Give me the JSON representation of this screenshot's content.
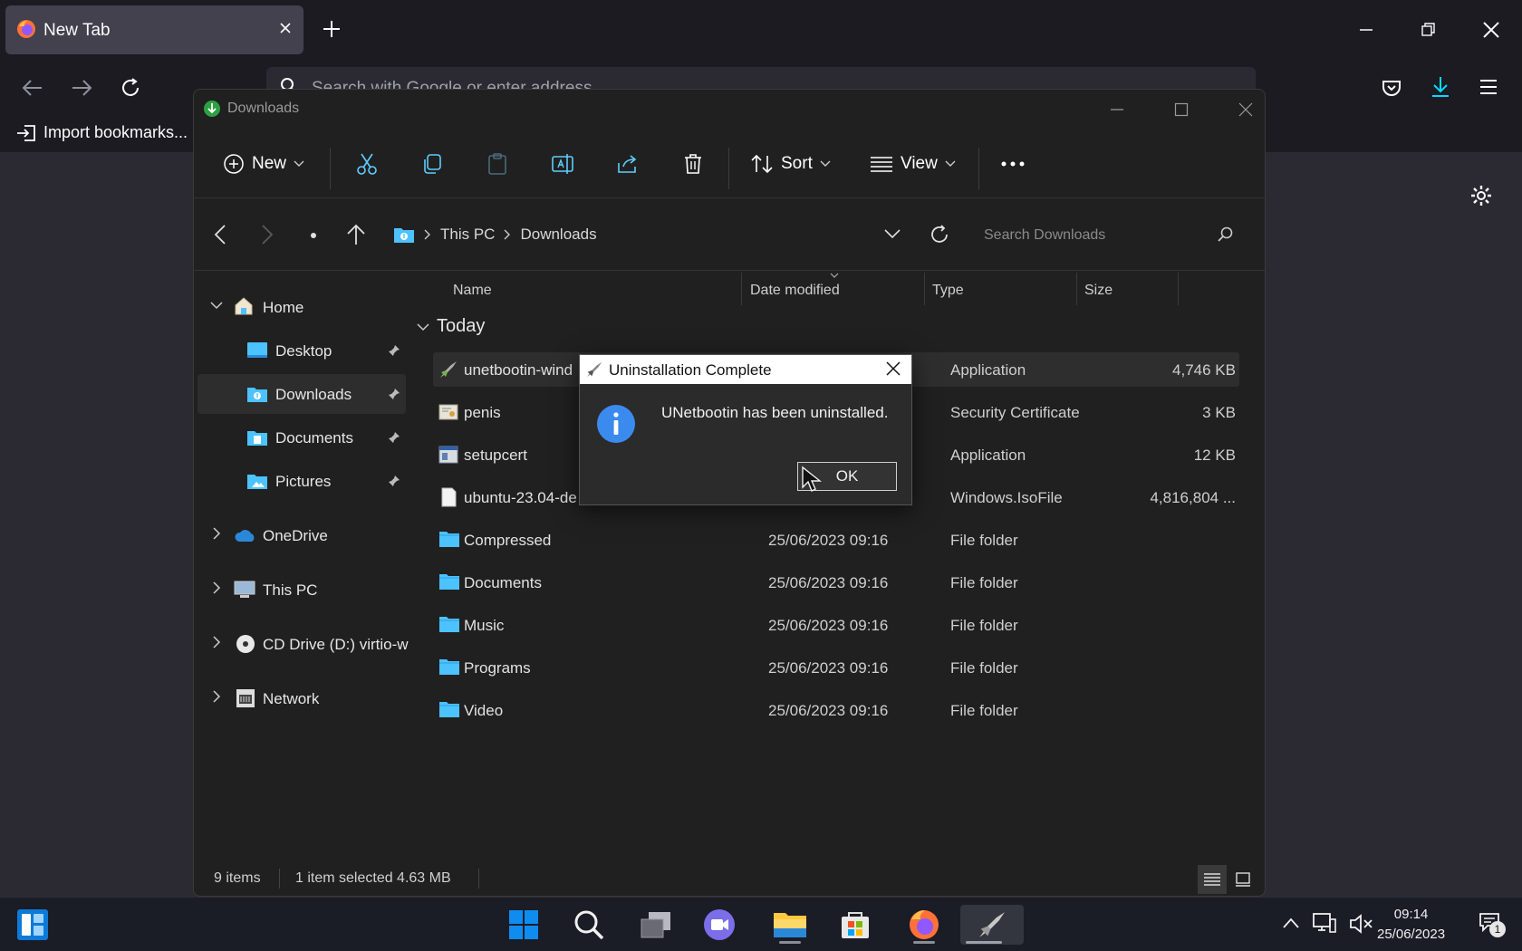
{
  "browser": {
    "tab_title": "New Tab",
    "url_placeholder": "Search with Google or enter address",
    "bookmark_import": "Import bookmarks..."
  },
  "explorer": {
    "window_title": "Downloads",
    "toolbar": {
      "new_label": "New",
      "sort_label": "Sort",
      "view_label": "View"
    },
    "breadcrumb": [
      "This PC",
      "Downloads"
    ],
    "search_placeholder": "Search Downloads",
    "nav": {
      "home": "Home",
      "desktop": "Desktop",
      "downloads": "Downloads",
      "documents": "Documents",
      "pictures": "Pictures",
      "onedrive": "OneDrive",
      "thispc": "This PC",
      "cddrive": "CD Drive (D:) virtio-w",
      "network": "Network"
    },
    "columns": {
      "name": "Name",
      "date": "Date modified",
      "type": "Type",
      "size": "Size"
    },
    "group_today": "Today",
    "files": [
      {
        "name": "unetbootin-wind",
        "date": "",
        "type": "Application",
        "size": "4,746 KB"
      },
      {
        "name": "penis",
        "date": "",
        "type": "Security Certificate",
        "size": "3 KB"
      },
      {
        "name": "setupcert",
        "date": "",
        "type": "Application",
        "size": "12 KB"
      },
      {
        "name": "ubuntu-23.04-de",
        "date": "",
        "type": "Windows.IsoFile",
        "size": "4,816,804 ..."
      },
      {
        "name": "Compressed",
        "date": "25/06/2023 09:16",
        "type": "File folder",
        "size": ""
      },
      {
        "name": "Documents",
        "date": "25/06/2023 09:16",
        "type": "File folder",
        "size": ""
      },
      {
        "name": "Music",
        "date": "25/06/2023 09:16",
        "type": "File folder",
        "size": ""
      },
      {
        "name": "Programs",
        "date": "25/06/2023 09:16",
        "type": "File folder",
        "size": ""
      },
      {
        "name": "Video",
        "date": "25/06/2023 09:16",
        "type": "File folder",
        "size": ""
      }
    ],
    "status": {
      "items": "9 items",
      "selection": "1 item selected  4.63 MB"
    }
  },
  "dialog": {
    "title": "Uninstallation Complete",
    "message": "UNetbootin has been uninstalled.",
    "ok_label": "OK"
  },
  "taskbar": {
    "time": "09:14",
    "date": "25/06/2023",
    "notifications": "1"
  },
  "colors": {
    "folder": "#4cc2ff",
    "info": "#3b8bef",
    "accent_download": "#00ddff"
  }
}
